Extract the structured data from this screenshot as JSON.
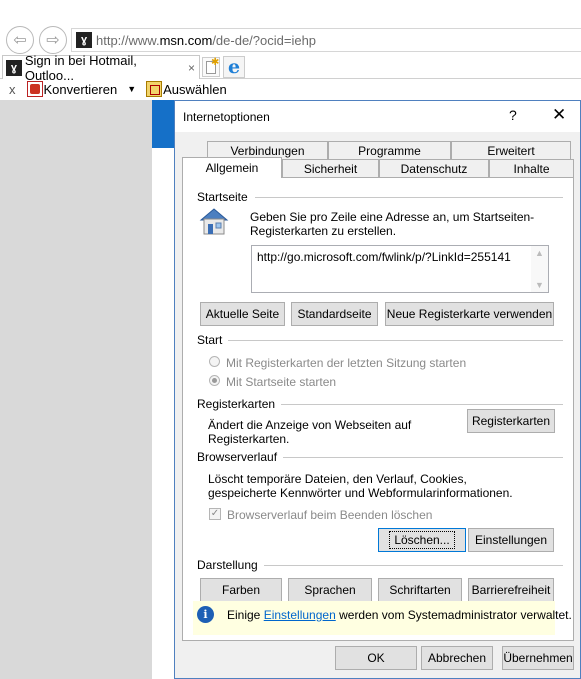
{
  "browser": {
    "url_prefix": "http://www.",
    "url_domain": "msn.com",
    "url_suffix": "/de-de/?ocid=iehp",
    "tab_title": "Sign in bei Hotmail, Outloo...",
    "tab_close": "×",
    "cmd_close": "x",
    "convert_label": "Konvertieren",
    "select_label": "Auswählen"
  },
  "dialog": {
    "title": "Internetoptionen",
    "help": "?",
    "close": "✕",
    "tabs_back": [
      "Verbindungen",
      "Programme",
      "Erweitert"
    ],
    "tabs_front": [
      "Allgemein",
      "Sicherheit",
      "Datenschutz",
      "Inhalte"
    ],
    "startseite": {
      "heading": "Startseite",
      "description": "Geben Sie pro Zeile eine Adresse an, um Startseiten-Registerkarten zu erstellen.",
      "url": "http://go.microsoft.com/fwlink/p/?LinkId=255141",
      "btn_current": "Aktuelle Seite",
      "btn_default": "Standardseite",
      "btn_newtab": "Neue Registerkarte verwenden"
    },
    "start": {
      "heading": "Start",
      "option1": "Mit Registerkarten der letzten Sitzung starten",
      "option2": "Mit Startseite starten"
    },
    "registerkarten": {
      "heading": "Registerkarten",
      "description": "Ändert die Anzeige von Webseiten auf Registerkarten.",
      "button": "Registerkarten"
    },
    "browserverlauf": {
      "heading": "Browserverlauf",
      "description": "Löscht temporäre Dateien, den Verlauf, Cookies, gespeicherte Kennwörter und Webformularinformationen.",
      "checkbox": "Browserverlauf beim Beenden löschen",
      "btn_delete": "Löschen...",
      "btn_settings": "Einstellungen"
    },
    "darstellung": {
      "heading": "Darstellung",
      "btn_colors": "Farben",
      "btn_languages": "Sprachen",
      "btn_fonts": "Schriftarten",
      "btn_accessibility": "Barrierefreiheit"
    },
    "info": {
      "pre": "Einige ",
      "link": "Einstellungen",
      "post": " werden vom Systemadministrator verwaltet."
    },
    "footer": {
      "ok": "OK",
      "cancel": "Abbrechen",
      "apply": "Übernehmen"
    }
  },
  "colors": {
    "accent": "#0078d7",
    "msn_blue": "#1570c8",
    "info_bg": "#ffffe1"
  }
}
